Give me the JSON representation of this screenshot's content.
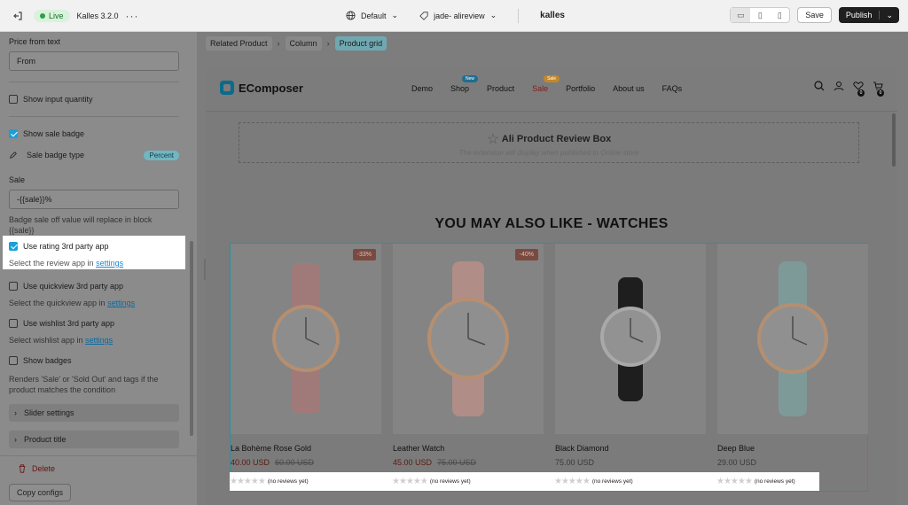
{
  "topbar": {
    "status": "Live",
    "app_name": "Kalles 3.2.0",
    "language": "Default",
    "page": "jade- alireview",
    "brand": "kalles",
    "save_label": "Save",
    "publish_label": "Publish"
  },
  "sidebar": {
    "price_from_label": "Price from text",
    "price_from_value": "From",
    "show_input_quantity": {
      "label": "Show input quantity",
      "checked": false
    },
    "show_sale_badge": {
      "label": "Show sale badge",
      "checked": true
    },
    "sale_badge_type_label": "Sale badge type",
    "sale_badge_type_value": "Percent",
    "sale_label": "Sale",
    "sale_value": "-{{sale}}%",
    "sale_hint": "Badge sale off value will replace in block {{sale}}",
    "use_rating": {
      "label": "Use rating 3rd party app",
      "checked": true,
      "hint": "Select the review app in",
      "link": "settings"
    },
    "use_quickview": {
      "label": "Use quickview 3rd party app",
      "checked": false,
      "hint": "Select the quickview app in",
      "link": "settings"
    },
    "use_wishlist": {
      "label": "Use wishlist 3rd party app",
      "checked": false,
      "hint": "Select wishlist app in",
      "link": "settings"
    },
    "show_badges": {
      "label": "Show badges",
      "checked": false,
      "hint": "Renders 'Sale' or 'Sold Out' and tags if the product matches the condition"
    },
    "slider_settings": "Slider settings",
    "product_title": "Product title",
    "delete_label": "Delete",
    "copy_label": "Copy configs"
  },
  "breadcrumb": [
    "Related Product",
    "Column",
    "Product grid"
  ],
  "site": {
    "logo": "EComposer",
    "nav": [
      {
        "label": "Demo"
      },
      {
        "label": "Shop",
        "badge": "New"
      },
      {
        "label": "Product"
      },
      {
        "label": "Sale",
        "badge": "Sale"
      },
      {
        "label": "Portfolio"
      },
      {
        "label": "About us"
      },
      {
        "label": "FAQs"
      }
    ],
    "wishlist_count": "0",
    "cart_count": "0"
  },
  "review_box": {
    "title": "Ali Product Review Box",
    "subtitle": "The extension will display when published to Online store"
  },
  "section_title": "YOU MAY ALSO LIKE - WATCHES",
  "products": [
    {
      "name": "La Bohème Rose Gold",
      "price": "40.00 USD",
      "old_price": "60.00 USD",
      "discount": "-33%",
      "strap": "#a07a79",
      "reviews": "(no reviews yet)"
    },
    {
      "name": "Leather Watch",
      "price": "45.00 USD",
      "old_price": "75.00 USD",
      "discount": "-40%",
      "strap": "#b08d86",
      "reviews": "(no reviews yet)"
    },
    {
      "name": "Black Diamond",
      "price": "75.00 USD",
      "old_price": "",
      "discount": "",
      "strap": "#1e1e1e",
      "reviews": "(no reviews yet)"
    },
    {
      "name": "Deep Blue",
      "price": "29.00 USD",
      "old_price": "",
      "discount": "",
      "strap": "#7d9a99",
      "reviews": "(no reviews yet)"
    }
  ]
}
